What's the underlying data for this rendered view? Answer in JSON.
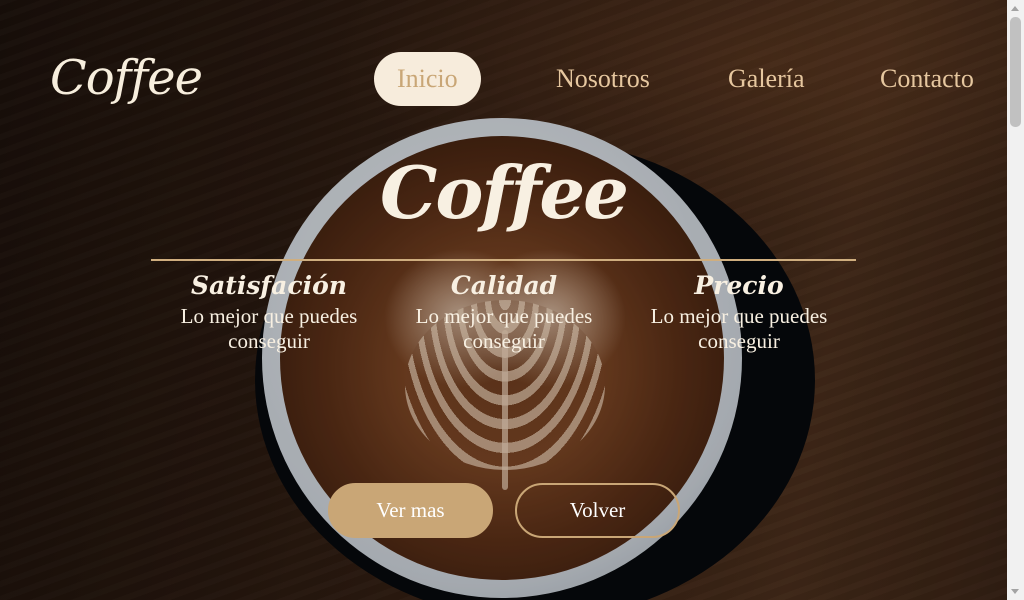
{
  "header": {
    "logo": "Coffee",
    "nav": [
      {
        "label": "Inicio",
        "active": true
      },
      {
        "label": "Nosotros",
        "active": false
      },
      {
        "label": "Galería",
        "active": false
      },
      {
        "label": "Contacto",
        "active": false
      }
    ]
  },
  "hero": {
    "title": "Coffee",
    "features": [
      {
        "title": "Satisfación",
        "text": "Lo mejor que puedes conseguir"
      },
      {
        "title": "Calidad",
        "text": "Lo mejor que puedes conseguir"
      },
      {
        "title": "Precio",
        "text": "Lo mejor que puedes conseguir"
      }
    ],
    "buttons": {
      "primary": "Ver mas",
      "secondary": "Volver"
    }
  },
  "colors": {
    "accent": "#c9a676",
    "nav_text": "#e6c79f",
    "light": "#f7ecdc"
  }
}
